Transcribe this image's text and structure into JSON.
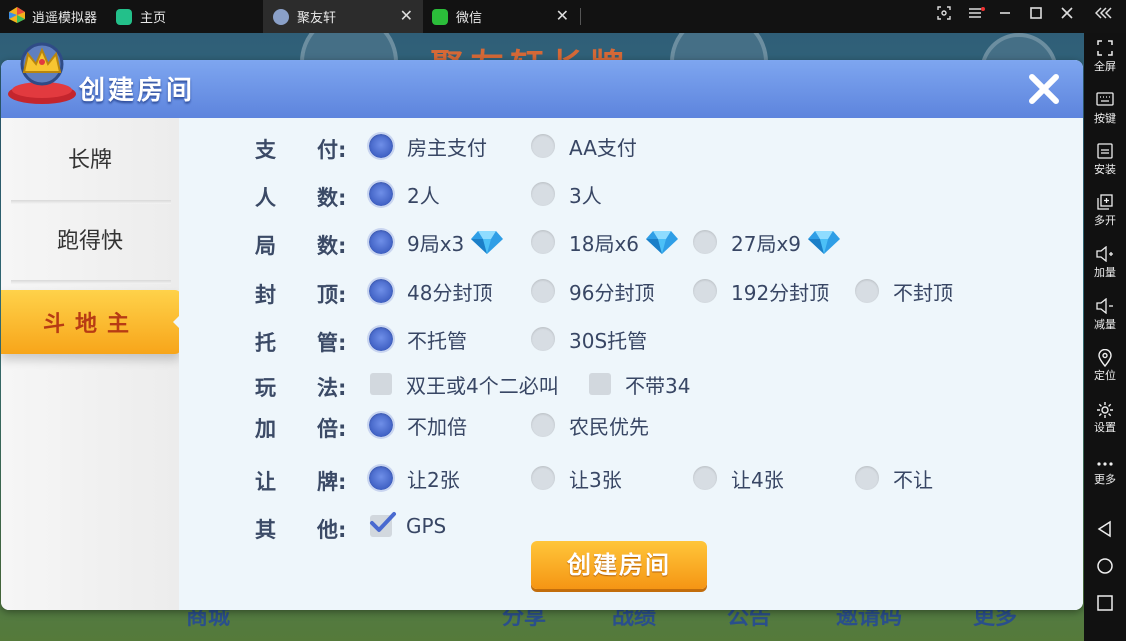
{
  "window": {
    "app_name": "逍遥模拟器",
    "tabs": [
      {
        "label": "主页"
      },
      {
        "label": "聚友轩"
      },
      {
        "label": "微信"
      }
    ],
    "close_glyph": "✕"
  },
  "sidebar": {
    "items": [
      {
        "label": "全屏",
        "icon": "fullscreen-icon"
      },
      {
        "label": "按键",
        "icon": "keyboard-icon"
      },
      {
        "label": "安装",
        "icon": "apk-icon"
      },
      {
        "label": "多开",
        "icon": "multi-instance-icon"
      },
      {
        "label": "加量",
        "icon": "volume-up-icon"
      },
      {
        "label": "减量",
        "icon": "volume-down-icon"
      },
      {
        "label": "定位",
        "icon": "location-icon"
      },
      {
        "label": "设置",
        "icon": "gear-icon"
      },
      {
        "label": "更多",
        "icon": "more-icon"
      }
    ]
  },
  "background": {
    "title": "聚友轩长牌",
    "bottom_items": [
      "商城",
      "分享",
      "战绩",
      "公告",
      "邀请码",
      "更多"
    ]
  },
  "dialog": {
    "title": "创建房间",
    "menu": [
      {
        "label": "长牌"
      },
      {
        "label": "跑得快"
      },
      {
        "label": "斗地主"
      }
    ],
    "rows": [
      {
        "label": [
          "支",
          "付:"
        ],
        "options": [
          "房主支付",
          "AA支付"
        ]
      },
      {
        "label": [
          "人",
          "数:"
        ],
        "options": [
          "2人",
          "3人"
        ]
      },
      {
        "label": [
          "局",
          "数:"
        ],
        "options": [
          "9局x3",
          "18局x6",
          "27局x9"
        ]
      },
      {
        "label": [
          "封",
          "顶:"
        ],
        "options": [
          "48分封顶",
          "96分封顶",
          "192分封顶",
          "不封顶"
        ]
      },
      {
        "label": [
          "托",
          "管:"
        ],
        "options": [
          "不托管",
          "30S托管"
        ]
      },
      {
        "label": [
          "玩",
          "法:"
        ],
        "options": [
          "双王或4个二必叫",
          "不带34"
        ]
      },
      {
        "label": [
          "加",
          "倍:"
        ],
        "options": [
          "不加倍",
          "农民优先"
        ]
      },
      {
        "label": [
          "让",
          "牌:"
        ],
        "options": [
          "让2张",
          "让3张",
          "让4张",
          "不让"
        ]
      },
      {
        "label": [
          "其",
          "他:"
        ],
        "options": [
          "GPS"
        ]
      }
    ],
    "create_button": "创建房间"
  },
  "colors": {
    "header_blue": "#6a90e6",
    "selected_radio": "#4a6ad0",
    "active_menu": "#f7a51a",
    "create_button": "#f59514"
  }
}
